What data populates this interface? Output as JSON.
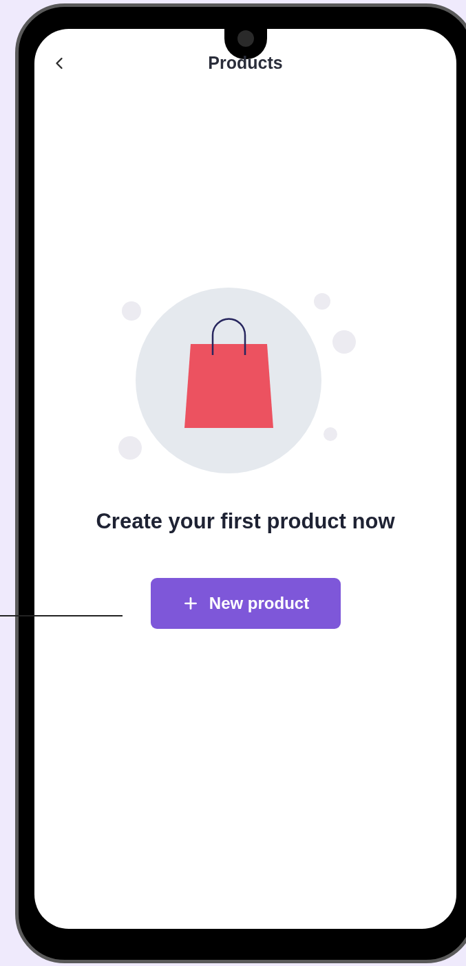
{
  "header": {
    "title": "Products"
  },
  "empty_state": {
    "message": "Create your first product now",
    "button": {
      "label": "New product"
    }
  }
}
